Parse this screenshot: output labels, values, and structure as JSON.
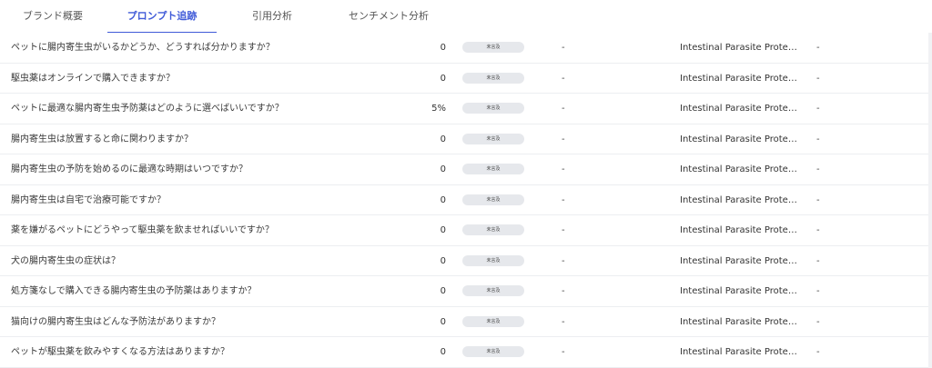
{
  "tabs": [
    {
      "label": "ブランド概要",
      "active": false
    },
    {
      "label": "プロンプト追跡",
      "active": true
    },
    {
      "label": "引用分析",
      "active": false
    },
    {
      "label": "センチメント分析",
      "active": false
    }
  ],
  "rows": [
    {
      "question": "ペットに腸内寄生虫がいるかどうか、どうすれば分かりますか？",
      "value": "0",
      "status": "未言及",
      "citation": "-",
      "topic": "Intestinal Parasite Protecti...",
      "extra": "-"
    },
    {
      "question": "駆虫薬はオンラインで購入できますか？",
      "value": "0",
      "status": "未言及",
      "citation": "-",
      "topic": "Intestinal Parasite Protecti...",
      "extra": "-"
    },
    {
      "question": "ペットに最適な腸内寄生虫予防薬はどのように選べばいいですか？",
      "value": "5%",
      "status": "未言及",
      "citation": "-",
      "topic": "Intestinal Parasite Protecti...",
      "extra": "-"
    },
    {
      "question": "腸内寄生虫は放置すると命に関わりますか？",
      "value": "0",
      "status": "未言及",
      "citation": "-",
      "topic": "Intestinal Parasite Protecti...",
      "extra": "-"
    },
    {
      "question": "腸内寄生虫の予防を始めるのに最適な時期はいつですか？",
      "value": "0",
      "status": "未言及",
      "citation": "-",
      "topic": "Intestinal Parasite Protecti...",
      "extra": "-"
    },
    {
      "question": "腸内寄生虫は自宅で治療可能ですか？",
      "value": "0",
      "status": "未言及",
      "citation": "-",
      "topic": "Intestinal Parasite Protecti...",
      "extra": "-"
    },
    {
      "question": "薬を嫌がるペットにどうやって駆虫薬を飲ませればいいですか？",
      "value": "0",
      "status": "未言及",
      "citation": "-",
      "topic": "Intestinal Parasite Protecti...",
      "extra": "-"
    },
    {
      "question": "犬の腸内寄生虫の症状は？",
      "value": "0",
      "status": "未言及",
      "citation": "-",
      "topic": "Intestinal Parasite Protecti...",
      "extra": "-"
    },
    {
      "question": "処方箋なしで購入できる腸内寄生虫の予防薬はありますか？",
      "value": "0",
      "status": "未言及",
      "citation": "-",
      "topic": "Intestinal Parasite Protecti...",
      "extra": "-"
    },
    {
      "question": "猫向けの腸内寄生虫はどんな予防法がありますか？",
      "value": "0",
      "status": "未言及",
      "citation": "-",
      "topic": "Intestinal Parasite Protecti...",
      "extra": "-"
    },
    {
      "question": "ペットが駆虫薬を飲みやすくなる方法はありますか？",
      "value": "0",
      "status": "未言及",
      "citation": "-",
      "topic": "Intestinal Parasite Protecti...",
      "extra": "-"
    }
  ]
}
